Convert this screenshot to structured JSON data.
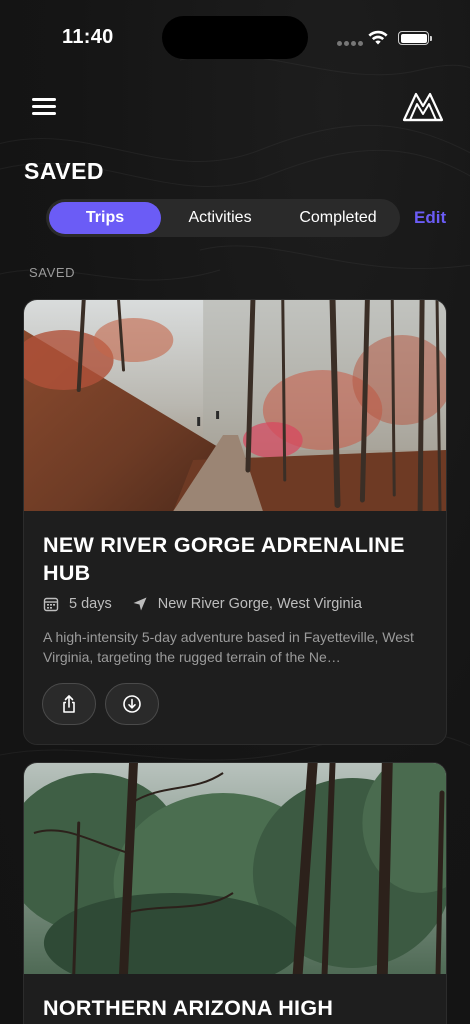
{
  "status_bar": {
    "time": "11:40"
  },
  "header": {
    "page_title": "SAVED"
  },
  "tabs": [
    {
      "label": "Trips",
      "active": true
    },
    {
      "label": "Activities",
      "active": false
    },
    {
      "label": "Completed",
      "active": false
    }
  ],
  "edit_label": "Edit",
  "section_label": "SAVED",
  "colors": {
    "accent": "#6b5cf6",
    "background": "#141414",
    "card": "#1e1e1e"
  },
  "trips": [
    {
      "title": "NEW RIVER GORGE ADRENALINE HUB",
      "duration": "5 days",
      "location": "New River Gorge, West Virginia",
      "description": "A high-intensity 5-day adventure based in Fayetteville, West Virginia, targeting the rugged terrain of the Ne…",
      "actions": [
        "share-icon",
        "download-icon"
      ]
    },
    {
      "title": "NORTHERN ARIZONA HIGH"
    }
  ]
}
